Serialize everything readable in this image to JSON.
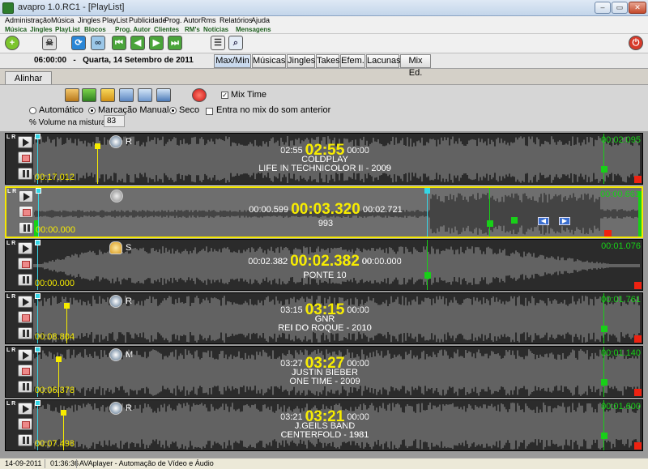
{
  "window": {
    "title": "avapro 1.0.RC1 - [PlayList]"
  },
  "menu": {
    "items": [
      "Administração",
      "Música",
      "Jingles",
      "PlayList",
      "Publicidade",
      "Prog. Autor",
      "Rms",
      "Relatórios",
      "Ajuda"
    ]
  },
  "quickbar": {
    "items": [
      "Música",
      "Jingles",
      "PlayList",
      "Blocos",
      "Prog. Autor",
      "Clientes",
      "RM's",
      "Notícias",
      "Mensagens"
    ]
  },
  "datebar": {
    "time": "06:00:00",
    "sep": "-",
    "date": "Quarta, 14 Setembro de 2011"
  },
  "tabs": [
    "Max/Min",
    "Músicas",
    "Jingles",
    "Takes",
    "Efem.",
    "Lacunas",
    "Mix Ed."
  ],
  "alinhar": {
    "tab": "Alinhar"
  },
  "controls": {
    "mix_time_label": "Mix Time",
    "mix_time_checked": true,
    "mode_options": [
      "Automático",
      "Marcação Manual",
      "Seco"
    ],
    "mode_selected": "Marcação Manual",
    "entra_mix_label": "Entra no mix do som anterior",
    "entra_mix_checked": false,
    "volume_label": "% Volume na mistura",
    "volume_value": "83"
  },
  "tracks": [
    {
      "lr": "L R",
      "pre": "02:55",
      "main": "02:55",
      "post": "00:00",
      "artist": "COLDPLAY",
      "title": "LIFE IN TECHNICOLOR II - 2009",
      "start": "00:17.012",
      "end": "00:02.095",
      "flag": "R",
      "icon": "g-icon"
    },
    {
      "lr": "L R",
      "pre": "00:00.599",
      "main": "00:03.320",
      "post": "00:02.721",
      "artist": "",
      "title": "993",
      "start": "00:00.000",
      "end": "00:00.661",
      "flag": "",
      "icon": "mic-icon",
      "selected": true
    },
    {
      "lr": "L R",
      "pre": "00:02.382",
      "main": "00:02.382",
      "post": "00:00.000",
      "artist": "",
      "title": "PONTE 10",
      "start": "00:00.000",
      "end": "00:01.076",
      "flag": "S",
      "icon": "bell-icon"
    },
    {
      "lr": "L R",
      "pre": "03:15",
      "main": "03:15",
      "post": "00:00",
      "artist": "GNR",
      "title": "REI DO ROQUE - 2010",
      "start": "00:08.804",
      "end": "00:01.761",
      "flag": "R",
      "icon": "g-icon"
    },
    {
      "lr": "L R",
      "pre": "03:27",
      "main": "03:27",
      "post": "00:00",
      "artist": "JUSTIN BIEBER",
      "title": "ONE TIME - 2009",
      "start": "00:06.378",
      "end": "00:01.140",
      "flag": "M",
      "icon": "g-icon"
    },
    {
      "lr": "L R",
      "pre": "03:21",
      "main": "03:21",
      "post": "00:00",
      "artist": "J.GEILS BAND",
      "title": "CENTERFOLD - 1981",
      "start": "00:07.498",
      "end": "00:01.600",
      "flag": "R",
      "icon": "g-icon"
    }
  ],
  "status": {
    "date": "14-09-2011",
    "time": "01:36:36",
    "app": "AVAplayer - Automação de Vídeo e Áudio"
  }
}
